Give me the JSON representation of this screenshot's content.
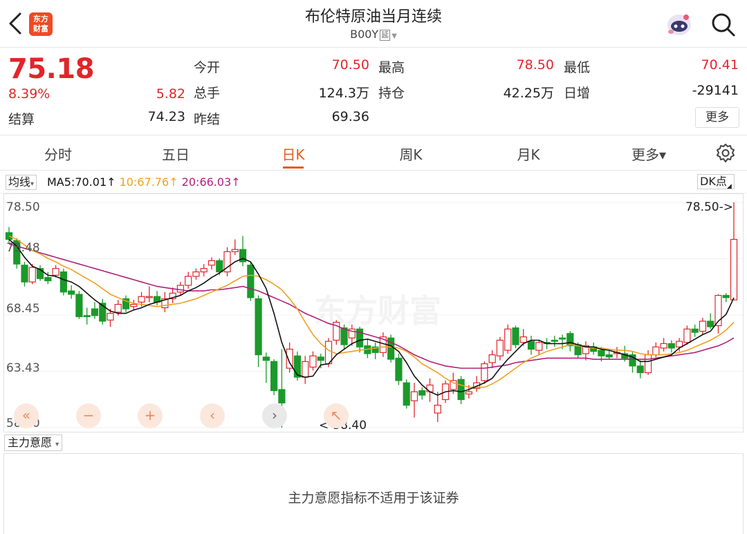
{
  "header": {
    "title": "布伦特原油当月连续",
    "code": "B00Y",
    "delay_tag": "延",
    "logo_line1": "东方",
    "logo_line2": "财富"
  },
  "quote": {
    "price": "75.18",
    "change_pct": "8.39%",
    "change": "5.82",
    "settle_label": "结算",
    "settle_value": "74.23",
    "open_label": "今开",
    "open_value": "70.50",
    "high_label": "最高",
    "high_value": "78.50",
    "low_label": "最低",
    "low_value": "70.41",
    "volume_label": "总手",
    "volume_value": "124.3万",
    "oi_label": "持仓",
    "oi_value": "42.25万",
    "daily_inc_label": "日增",
    "daily_inc_value": "-29141",
    "prev_settle_label": "昨结",
    "prev_settle_value": "69.36",
    "more_label": "更多"
  },
  "tabs": [
    {
      "label": "分时",
      "active": false
    },
    {
      "label": "五日",
      "active": false
    },
    {
      "label": "日K",
      "active": true
    },
    {
      "label": "周K",
      "active": false
    },
    {
      "label": "月K",
      "active": false
    },
    {
      "label": "更多▾",
      "active": false
    }
  ],
  "ma_legend": {
    "selector": "均线",
    "ma5": "MA5:70.01↑",
    "ma10": "10:67.76↑",
    "ma20": "20:66.03↑",
    "dk_label": "DK点",
    "colors": {
      "ma5": "#111111",
      "ma10": "#f0a020",
      "ma20": "#b0207a"
    }
  },
  "indicator": {
    "selector": "主力意愿",
    "message": "主力意愿指标不适用于该证券"
  },
  "controls": [
    "«",
    "−",
    "+",
    "‹",
    "›",
    "↖"
  ],
  "chart_data": {
    "type": "candlestick",
    "y_ticks": [
      "78.50",
      "73.48",
      "68.45",
      "63.43",
      "58.40"
    ],
    "ylim": [
      58.4,
      78.5
    ],
    "watermark": "东方财富",
    "high_marker": "78.50->",
    "low_marker": "<-58.40",
    "up_color": "#e0262b",
    "down_color": "#1a9a2a",
    "candles": [
      [
        75.8,
        75.2,
        76.3,
        74.9
      ],
      [
        75.1,
        73.0,
        75.3,
        72.6
      ],
      [
        72.9,
        71.4,
        73.2,
        71.0
      ],
      [
        71.4,
        72.7,
        73.0,
        71.2
      ],
      [
        72.6,
        71.7,
        72.9,
        71.5
      ],
      [
        71.8,
        71.5,
        72.3,
        71.2
      ],
      [
        72.0,
        72.6,
        72.9,
        71.8
      ],
      [
        72.3,
        70.5,
        72.6,
        70.2
      ],
      [
        70.6,
        70.3,
        71.1,
        69.9
      ],
      [
        70.3,
        68.3,
        70.6,
        68.1
      ],
      [
        68.4,
        68.3,
        69.1,
        67.6
      ],
      [
        69.0,
        68.4,
        69.6,
        68.1
      ],
      [
        69.5,
        67.9,
        69.9,
        67.6
      ],
      [
        68.0,
        68.6,
        69.0,
        67.4
      ],
      [
        68.7,
        69.4,
        69.8,
        68.4
      ],
      [
        69.9,
        69.0,
        70.2,
        68.7
      ],
      [
        69.2,
        69.4,
        69.8,
        68.9
      ],
      [
        69.6,
        70.1,
        70.5,
        69.2
      ],
      [
        70.0,
        70.1,
        71.0,
        69.6
      ],
      [
        70.1,
        69.6,
        70.6,
        69.3
      ],
      [
        69.1,
        69.9,
        70.5,
        68.7
      ],
      [
        69.9,
        70.4,
        70.9,
        69.5
      ],
      [
        70.5,
        71.1,
        71.4,
        70.2
      ],
      [
        71.1,
        71.9,
        72.3,
        70.8
      ],
      [
        71.9,
        72.3,
        72.6,
        71.6
      ],
      [
        72.3,
        72.6,
        73.0,
        71.9
      ],
      [
        72.9,
        73.3,
        73.6,
        72.5
      ],
      [
        73.3,
        72.3,
        73.5,
        72.0
      ],
      [
        72.3,
        74.1,
        74.5,
        71.9
      ],
      [
        74.1,
        74.3,
        75.2,
        73.8
      ],
      [
        74.3,
        73.2,
        75.5,
        72.8
      ],
      [
        72.9,
        70.0,
        73.2,
        69.7
      ],
      [
        69.9,
        64.9,
        70.2,
        63.8
      ],
      [
        64.7,
        64.4,
        65.1,
        62.4
      ],
      [
        64.3,
        61.7,
        64.5,
        61.3
      ],
      [
        61.8,
        60.6,
        65.4,
        58.4
      ],
      [
        63.7,
        65.4,
        66.0,
        63.3
      ],
      [
        64.8,
        62.9,
        65.2,
        62.6
      ],
      [
        62.9,
        64.3,
        64.8,
        62.3
      ],
      [
        63.8,
        64.8,
        65.2,
        63.5
      ],
      [
        64.7,
        64.4,
        65.0,
        63.7
      ],
      [
        64.1,
        66.1,
        66.4,
        63.8
      ],
      [
        66.2,
        67.8,
        68.0,
        65.8
      ],
      [
        67.3,
        65.8,
        67.6,
        65.4
      ],
      [
        66.4,
        67.2,
        67.6,
        65.7
      ],
      [
        67.2,
        65.6,
        67.4,
        65.1
      ],
      [
        65.7,
        65.0,
        66.3,
        64.6
      ],
      [
        65.6,
        65.1,
        66.0,
        64.5
      ],
      [
        65.1,
        66.5,
        66.9,
        64.7
      ],
      [
        66.4,
        64.5,
        66.7,
        64.2
      ],
      [
        64.6,
        62.6,
        65.0,
        62.2
      ],
      [
        62.4,
        60.4,
        62.7,
        60.1
      ],
      [
        60.8,
        61.6,
        62.4,
        59.3
      ],
      [
        61.7,
        61.3,
        62.0,
        60.9
      ],
      [
        61.6,
        62.2,
        62.8,
        60.7
      ],
      [
        59.7,
        60.4,
        61.6,
        58.9
      ],
      [
        60.9,
        62.3,
        62.6,
        60.6
      ],
      [
        61.8,
        62.6,
        63.3,
        61.4
      ],
      [
        62.7,
        60.9,
        63.0,
        60.5
      ],
      [
        61.4,
        61.6,
        62.2,
        61.0
      ],
      [
        61.9,
        62.4,
        63.0,
        61.6
      ],
      [
        62.6,
        64.1,
        64.3,
        62.3
      ],
      [
        64.2,
        64.9,
        65.3,
        63.7
      ],
      [
        64.8,
        66.2,
        66.5,
        64.4
      ],
      [
        65.3,
        67.2,
        67.6,
        65.0
      ],
      [
        67.3,
        65.8,
        67.5,
        65.5
      ],
      [
        66.0,
        66.5,
        67.2,
        65.7
      ],
      [
        66.1,
        65.4,
        66.6,
        64.9
      ],
      [
        65.3,
        66.0,
        66.2,
        64.9
      ],
      [
        66.0,
        65.9,
        66.4,
        65.4
      ],
      [
        66.2,
        66.1,
        66.6,
        65.6
      ],
      [
        66.4,
        66.3,
        66.7,
        65.4
      ],
      [
        66.8,
        65.7,
        67.0,
        65.2
      ],
      [
        65.8,
        64.9,
        66.0,
        64.6
      ],
      [
        65.0,
        65.7,
        66.1,
        64.4
      ],
      [
        65.6,
        65.2,
        66.0,
        64.9
      ],
      [
        65.3,
        64.8,
        65.6,
        64.3
      ],
      [
        64.9,
        64.7,
        65.3,
        64.5
      ],
      [
        65.0,
        65.1,
        65.6,
        64.6
      ],
      [
        65.0,
        64.6,
        65.7,
        64.3
      ],
      [
        64.9,
        63.9,
        65.2,
        63.3
      ],
      [
        63.9,
        63.3,
        64.4,
        62.8
      ],
      [
        63.3,
        64.9,
        65.3,
        63.1
      ],
      [
        64.9,
        65.6,
        66.0,
        64.7
      ],
      [
        65.5,
        65.9,
        66.4,
        65.2
      ],
      [
        65.9,
        65.5,
        66.2,
        65.1
      ],
      [
        65.6,
        66.1,
        66.4,
        65.2
      ],
      [
        66.0,
        67.2,
        67.5,
        65.8
      ],
      [
        67.2,
        66.9,
        67.6,
        66.5
      ],
      [
        67.0,
        67.9,
        68.2,
        66.7
      ],
      [
        67.9,
        67.4,
        68.6,
        67.2
      ],
      [
        67.5,
        70.2,
        70.3,
        66.8
      ],
      [
        70.2,
        70.0,
        70.4,
        69.6
      ],
      [
        69.8,
        75.2,
        78.5,
        70.4
      ]
    ],
    "ma5": [
      75.2,
      74.6,
      73.6,
      72.8,
      72.5,
      72.0,
      71.9,
      71.6,
      71.4,
      71.0,
      70.4,
      69.8,
      69.3,
      68.8,
      68.6,
      68.6,
      68.9,
      69.1,
      69.4,
      69.6,
      69.8,
      70.0,
      70.2,
      70.6,
      70.9,
      71.3,
      71.8,
      72.2,
      72.7,
      73.2,
      73.5,
      73.2,
      72.1,
      70.8,
      68.6,
      66.0,
      64.2,
      63.1,
      62.9,
      63.0,
      64.0,
      64.1,
      64.9,
      65.4,
      65.9,
      66.2,
      66.3,
      66.1,
      65.9,
      65.7,
      65.2,
      64.2,
      63.0,
      62.2,
      61.6,
      61.3,
      61.6,
      61.7,
      61.6,
      61.8,
      62.1,
      62.4,
      62.8,
      63.7,
      64.5,
      65.2,
      65.9,
      66.2,
      66.2,
      65.9,
      65.9,
      65.9,
      66.0,
      65.8,
      65.6,
      65.6,
      65.4,
      65.3,
      65.1,
      64.9,
      64.7,
      64.3,
      64.3,
      64.5,
      64.7,
      64.9,
      65.5,
      65.9,
      66.3,
      66.7,
      67.0,
      67.9,
      68.5,
      70.0
    ],
    "ma10": [
      75.5,
      75.2,
      74.7,
      74.2,
      73.9,
      73.5,
      73.2,
      72.8,
      72.5,
      72.1,
      71.7,
      71.3,
      70.8,
      70.3,
      70.0,
      69.7,
      69.5,
      69.4,
      69.3,
      69.2,
      69.3,
      69.4,
      69.5,
      69.7,
      69.9,
      70.2,
      70.5,
      70.8,
      71.1,
      71.5,
      71.9,
      72.0,
      71.9,
      71.6,
      71.2,
      70.7,
      69.9,
      69.0,
      67.8,
      66.7,
      65.9,
      65.3,
      65.0,
      65.1,
      65.2,
      65.3,
      65.4,
      65.5,
      65.6,
      65.6,
      65.5,
      65.2,
      64.7,
      64.1,
      63.7,
      63.3,
      62.8,
      62.4,
      62.2,
      62.0,
      62.0,
      62.0,
      62.3,
      62.7,
      63.2,
      63.7,
      64.2,
      64.6,
      64.9,
      65.2,
      65.4,
      65.6,
      65.8,
      65.7,
      65.6,
      65.5,
      65.5,
      65.4,
      65.3,
      65.3,
      65.2,
      65.0,
      64.9,
      64.9,
      64.9,
      65.0,
      65.1,
      65.3,
      65.6,
      65.9,
      66.2,
      66.6,
      67.1,
      67.8
    ],
    "ma20": [
      74.8,
      74.6,
      74.4,
      74.2,
      74.0,
      73.8,
      73.6,
      73.4,
      73.2,
      73.0,
      72.8,
      72.6,
      72.4,
      72.2,
      72.0,
      71.8,
      71.6,
      71.4,
      71.2,
      71.0,
      70.9,
      70.8,
      70.7,
      70.6,
      70.6,
      70.6,
      70.7,
      70.7,
      70.8,
      70.9,
      71.0,
      70.8,
      70.6,
      70.3,
      70.0,
      69.7,
      69.4,
      69.0,
      68.6,
      68.3,
      68.0,
      67.7,
      67.5,
      67.2,
      67.0,
      66.9,
      66.7,
      66.5,
      66.3,
      66.0,
      65.7,
      65.3,
      64.9,
      64.6,
      64.3,
      64.1,
      63.9,
      63.8,
      63.7,
      63.7,
      63.7,
      63.7,
      63.8,
      63.9,
      64.0,
      64.2,
      64.3,
      64.4,
      64.5,
      64.6,
      64.6,
      64.6,
      64.6,
      64.6,
      64.6,
      64.5,
      64.5,
      64.5,
      64.5,
      64.5,
      64.5,
      64.5,
      64.5,
      64.6,
      64.7,
      64.8,
      64.9,
      65.0,
      65.1,
      65.3,
      65.5,
      65.7,
      66.0,
      66.4
    ]
  }
}
